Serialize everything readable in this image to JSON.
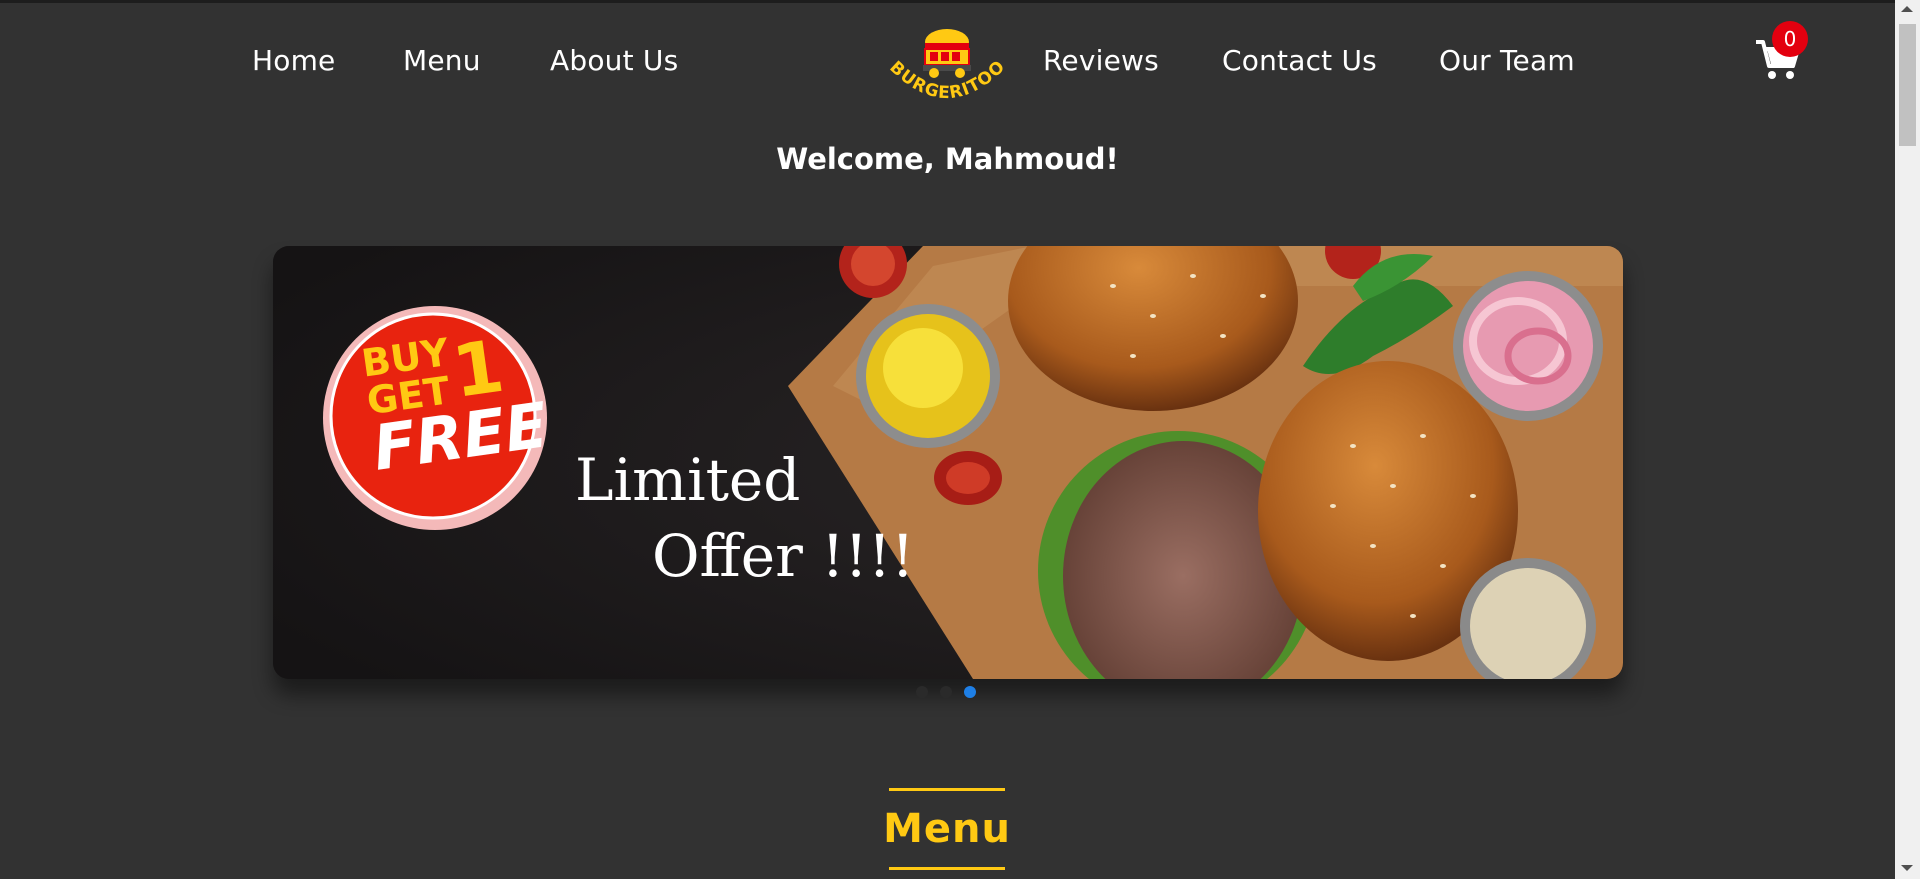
{
  "nav": {
    "left_items": [
      {
        "label": "Home"
      },
      {
        "label": "Menu"
      },
      {
        "label": "About Us"
      }
    ],
    "right_items": [
      {
        "label": "Reviews"
      },
      {
        "label": "Contact Us"
      },
      {
        "label": "Our Team"
      }
    ],
    "logo_text": "BURGERITOO",
    "cart": {
      "icon": "cart-icon",
      "count": "0"
    }
  },
  "welcome": "Welcome, Mahmoud!",
  "banner": {
    "badge_line1": "BUY",
    "badge_number": "1",
    "badge_line2": "GET",
    "badge_line3": "FREE",
    "offer_line1": "Limited",
    "offer_line2": "Offer !!!!",
    "slides": 3,
    "active_slide": 3
  },
  "section": {
    "menu_title": "Menu"
  },
  "colors": {
    "background": "#323232",
    "accent": "#ffc913",
    "badge": "#e3000f",
    "active_dot": "#1e7fe6"
  }
}
